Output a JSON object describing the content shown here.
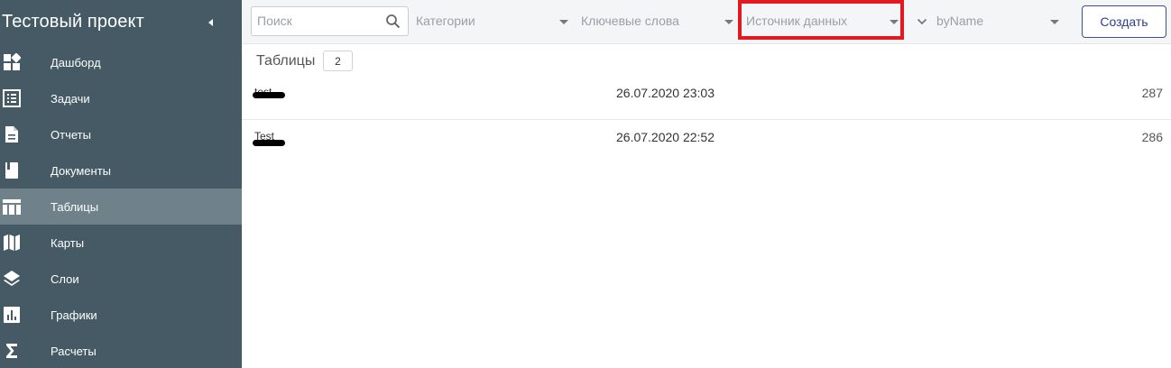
{
  "sidebar": {
    "title": "Тестовый проект",
    "items": [
      {
        "label": "Дашборд",
        "icon": "dashboard-icon"
      },
      {
        "label": "Задачи",
        "icon": "tasks-icon"
      },
      {
        "label": "Отчеты",
        "icon": "report-icon"
      },
      {
        "label": "Документы",
        "icon": "document-icon"
      },
      {
        "label": "Таблицы",
        "icon": "table-icon",
        "active": true
      },
      {
        "label": "Карты",
        "icon": "map-icon"
      },
      {
        "label": "Слои",
        "icon": "layers-icon"
      },
      {
        "label": "Графики",
        "icon": "chart-icon"
      },
      {
        "label": "Расчеты",
        "icon": "sigma-icon"
      }
    ]
  },
  "toolbar": {
    "search_placeholder": "Поиск",
    "categories_placeholder": "Категории",
    "keywords_placeholder": "Ключевые слова",
    "datasource_placeholder": "Источник данных",
    "sort_label": "byName",
    "create_label": "Создать"
  },
  "main": {
    "title": "Таблицы",
    "count": "2",
    "rows": [
      {
        "name": "test",
        "date": "26.07.2020 23:03",
        "count": "287"
      },
      {
        "name": "Test",
        "date": "26.07.2020 22:52",
        "count": "286"
      }
    ]
  },
  "colors": {
    "sidebar_bg": "#455a64",
    "sidebar_active": "#6f8289",
    "highlight": "#e3191f",
    "accent": "#2c3e8c"
  }
}
